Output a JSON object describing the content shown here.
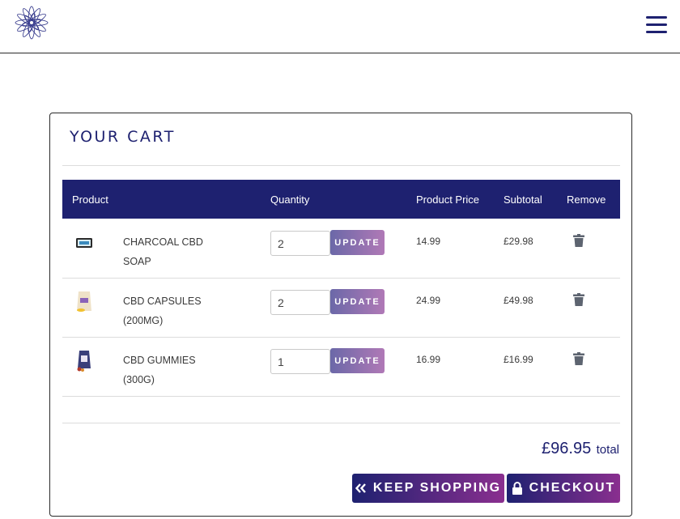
{
  "header": {
    "logo_icon": "lotus-flower-logo",
    "menu_icon": "hamburger-menu-icon"
  },
  "cart": {
    "title": "YOUR CART",
    "columns": {
      "product": "Product",
      "quantity": "Quantity",
      "price": "Product Price",
      "subtotal": "Subtotal",
      "remove": "Remove"
    },
    "items": [
      {
        "name": "CHARCOAL CBD SOAP",
        "quantity": "2",
        "update_label": "UPDATE",
        "price": "14.99",
        "subtotal": "£29.98",
        "thumb_icon": "soap-bar-icon",
        "remove_icon": "trash-icon"
      },
      {
        "name": "CBD CAPSULES (200MG)",
        "quantity": "2",
        "update_label": "UPDATE",
        "price": "24.99",
        "subtotal": "£49.98",
        "thumb_icon": "capsule-pouch-icon",
        "remove_icon": "trash-icon"
      },
      {
        "name": "CBD GUMMIES (300G)",
        "quantity": "1",
        "update_label": "UPDATE",
        "price": "16.99",
        "subtotal": "£16.99",
        "thumb_icon": "gummies-pouch-icon",
        "remove_icon": "trash-icon"
      }
    ],
    "total_amount": "£96.95",
    "total_label": "total",
    "keep_shopping_label": "KEEP SHOPPING",
    "checkout_label": "CHECKOUT"
  },
  "colors": {
    "navy": "#1e2170",
    "purple": "#8a2f8f",
    "update_gradient_start": "#6b68a8",
    "update_gradient_end": "#b079b6"
  }
}
